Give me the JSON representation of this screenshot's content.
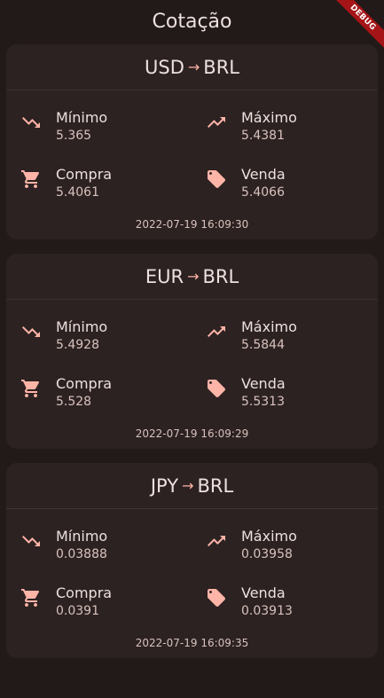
{
  "app_title": "Cotação",
  "debug_label": "DEBUG",
  "accent_color": "#ffb4a8",
  "labels": {
    "min": "Mínimo",
    "max": "Máximo",
    "buy": "Compra",
    "sell": "Venda",
    "arrow": "→"
  },
  "quotes": [
    {
      "from": "USD",
      "to": "BRL",
      "min": "5.365",
      "max": "5.4381",
      "buy": "5.4061",
      "sell": "5.4066",
      "timestamp": "2022-07-19 16:09:30"
    },
    {
      "from": "EUR",
      "to": "BRL",
      "min": "5.4928",
      "max": "5.5844",
      "buy": "5.528",
      "sell": "5.5313",
      "timestamp": "2022-07-19 16:09:29"
    },
    {
      "from": "JPY",
      "to": "BRL",
      "min": "0.03888",
      "max": "0.03958",
      "buy": "0.0391",
      "sell": "0.03913",
      "timestamp": "2022-07-19 16:09:35"
    }
  ],
  "icons": {
    "min": "trending-down-icon",
    "max": "trending-up-icon",
    "buy": "shopping-cart-icon",
    "sell": "price-tag-icon"
  }
}
